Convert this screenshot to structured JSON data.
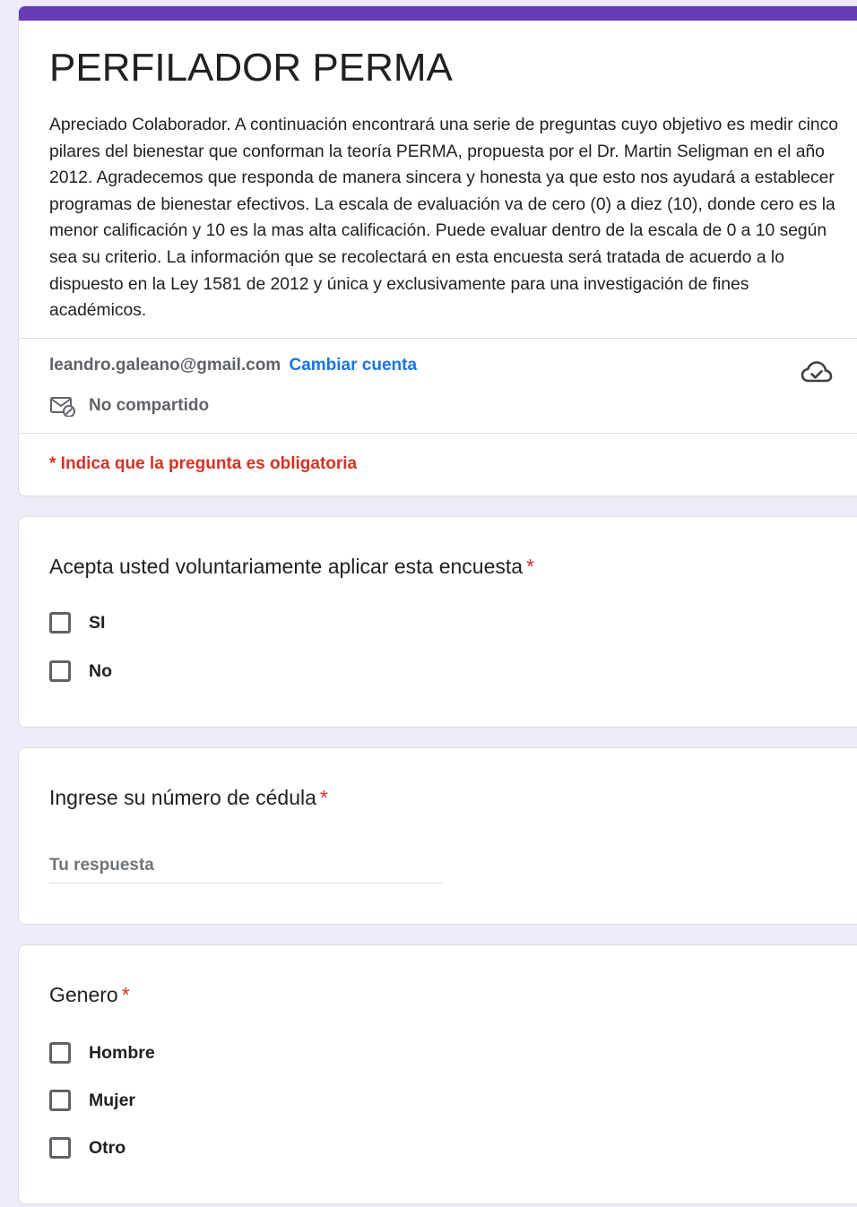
{
  "header": {
    "title": "PERFILADOR PERMA",
    "description": "Apreciado Colaborador. A continuación encontrará una serie de preguntas cuyo objetivo es medir cinco pilares del bienestar que conforman la teoría PERMA, propuesta por el Dr. Martin Seligman en el año 2012.  Agradecemos que responda de manera sincera y honesta ya que esto nos ayudará a establecer programas de bienestar efectivos. La escala de evaluación va de cero (0) a diez (10), donde cero es la menor calificación y 10 es la mas alta calificación. Puede evaluar dentro de la escala de 0 a 10 según sea su criterio. La información que se recolectará en esta encuesta será tratada de acuerdo a lo dispuesto en la Ley 1581 de 2012 y única y exclusivamente para una investigación de fines académicos.",
    "account_email": "leandro.galeano@gmail.com",
    "switch_account_label": "Cambiar cuenta",
    "not_shared_label": "No compartido",
    "required_note": "* Indica que la pregunta es obligatoria",
    "accent_color": "#673ab7"
  },
  "questions": [
    {
      "title": "Acepta usted voluntariamente aplicar esta encuesta",
      "required_mark": "*",
      "options": [
        "SI",
        "No"
      ]
    },
    {
      "title": "Ingrese su número de cédula",
      "required_mark": "*",
      "placeholder": "Tu respuesta"
    },
    {
      "title": "Genero",
      "required_mark": "*",
      "options": [
        "Hombre",
        "Mujer",
        "Otro"
      ]
    }
  ],
  "icons": {
    "cloud": "cloud-saved-icon",
    "mail": "mail-not-shared-icon"
  }
}
